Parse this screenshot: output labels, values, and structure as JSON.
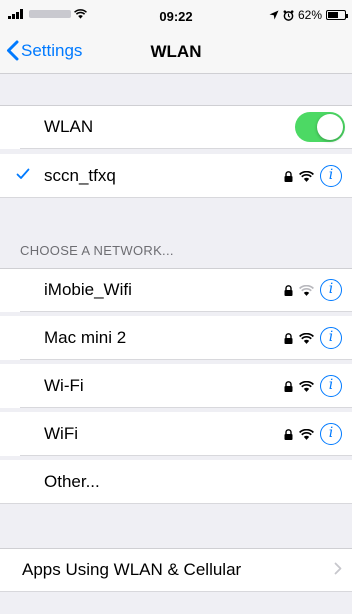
{
  "status_bar": {
    "time": "09:22",
    "battery_percent": "62%",
    "battery_level": 0.62,
    "icons": [
      "signal-icon",
      "wifi-icon",
      "location-icon",
      "alarm-icon",
      "battery-icon"
    ]
  },
  "nav": {
    "back_label": "Settings",
    "title": "WLAN"
  },
  "wlan_toggle": {
    "label": "WLAN",
    "on": true,
    "color": "#4cd964"
  },
  "connected_network": {
    "name": "sccn_tfxq",
    "locked": true
  },
  "choose_header": "CHOOSE A NETWORK...",
  "networks": [
    {
      "name": "iMobie_Wifi",
      "locked": true,
      "signal": "weak"
    },
    {
      "name": "Mac mini 2",
      "locked": true,
      "signal": "full"
    },
    {
      "name": "Wi-Fi",
      "locked": true,
      "signal": "full"
    },
    {
      "name": "WiFi",
      "locked": true,
      "signal": "full"
    }
  ],
  "other_label": "Other...",
  "apps_row_label": "Apps Using WLAN & Cellular",
  "accent_color": "#007aff"
}
